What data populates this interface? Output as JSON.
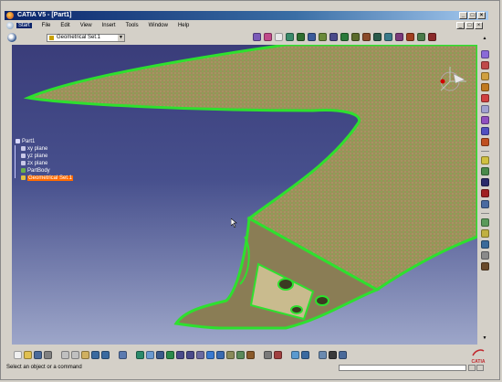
{
  "window": {
    "title": "CATIA V5 - [Part1]",
    "controls": [
      "_",
      "□",
      "×"
    ]
  },
  "menu": {
    "items": [
      "Start",
      "File",
      "Edit",
      "View",
      "Insert",
      "Tools",
      "Window",
      "Help"
    ],
    "active": "Start"
  },
  "toolbar": {
    "geometrical_set_value": "Geometrical Set.1"
  },
  "tree": {
    "root": "Part1",
    "children": [
      "xy plane",
      "yz plane",
      "zx plane",
      "PartBody",
      "Geometrical Set.1"
    ],
    "selected": "Geometrical Set.1"
  },
  "status": {
    "message": "Select an object or a command"
  },
  "logo": {
    "text": "CATIA"
  },
  "colors": {
    "viewport_top": "#3a3d7a",
    "viewport_bottom": "#9da6c9",
    "part_surface": "#9e8d5a",
    "part_edges": "#2ee02e",
    "selection": "#ff6a00"
  }
}
